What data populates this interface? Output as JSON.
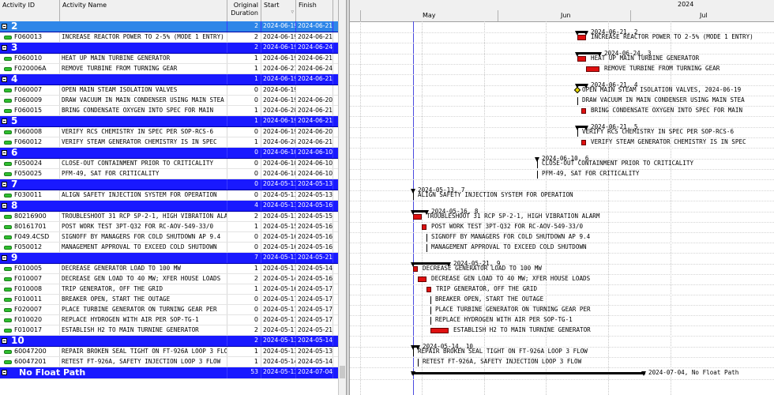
{
  "columns": {
    "id": "Activity ID",
    "name": "Activity Name",
    "dur1": "Original",
    "dur2": "Duration",
    "start": "Start",
    "finish": "Finish"
  },
  "timeline": {
    "year": "2024",
    "months": [
      "May",
      "Jun",
      "Jul"
    ]
  },
  "rows": [
    {
      "kind": "group",
      "label": "2",
      "dur": "2",
      "start": "2024-06-19",
      "finish": "2024-06-21",
      "selected": true
    },
    {
      "kind": "act",
      "id": "F060013",
      "name": "INCREASE REACTOR POWER TO 2-5% (MODE 1 ENTRY)",
      "dur": "2",
      "start": "2024-06-19",
      "finish": "2024-06-21"
    },
    {
      "kind": "group",
      "label": "3",
      "dur": "2",
      "start": "2024-06-19",
      "finish": "2024-06-24"
    },
    {
      "kind": "act",
      "id": "F060010",
      "name": "HEAT UP MAIN TURBINE GENERATOR",
      "dur": "1",
      "start": "2024-06-19",
      "finish": "2024-06-21"
    },
    {
      "kind": "act",
      "id": "F020006A",
      "name": "REMOVE TURBINE FROM TURNING GEAR",
      "dur": "1",
      "start": "2024-06-21",
      "finish": "2024-06-24"
    },
    {
      "kind": "group",
      "label": "4",
      "dur": "1",
      "start": "2024-06-19",
      "finish": "2024-06-21"
    },
    {
      "kind": "act",
      "id": "F060007",
      "name": "OPEN MAIN STEAM ISOLATION VALVES",
      "dur": "0",
      "start": "2024-06-19",
      "finish": ""
    },
    {
      "kind": "act",
      "id": "F060009",
      "name": "DRAW VACUUM IN MAIN CONDENSER USING MAIN STEA",
      "dur": "0",
      "start": "2024-06-19",
      "finish": "2024-06-20"
    },
    {
      "kind": "act",
      "id": "F060015",
      "name": "BRING CONDENSATE OXYGEN INTO SPEC FOR MAIN",
      "dur": "1",
      "start": "2024-06-20",
      "finish": "2024-06-21"
    },
    {
      "kind": "group",
      "label": "5",
      "dur": "1",
      "start": "2024-06-19",
      "finish": "2024-06-21"
    },
    {
      "kind": "act",
      "id": "F060008",
      "name": "VERIFY RCS CHEMISTRY IN SPEC PER SOP-RCS-6",
      "dur": "0",
      "start": "2024-06-19",
      "finish": "2024-06-20"
    },
    {
      "kind": "act",
      "id": "F060012",
      "name": "VERIFY STEAM GENERATOR CHEMISTRY IS IN SPEC",
      "dur": "1",
      "start": "2024-06-20",
      "finish": "2024-06-21"
    },
    {
      "kind": "group",
      "label": "6",
      "dur": "0",
      "start": "2024-06-10",
      "finish": "2024-06-10"
    },
    {
      "kind": "act",
      "id": "F050024",
      "name": "CLOSE-OUT CONTAINMENT PRIOR TO CRITICALITY",
      "dur": "0",
      "start": "2024-06-10",
      "finish": "2024-06-10"
    },
    {
      "kind": "act",
      "id": "F050025",
      "name": "PFM-49, SAT FOR CRITICALITY",
      "dur": "0",
      "start": "2024-06-10",
      "finish": "2024-06-10"
    },
    {
      "kind": "group",
      "label": "7",
      "dur": "0",
      "start": "2024-05-13",
      "finish": "2024-05-13"
    },
    {
      "kind": "act",
      "id": "F030011",
      "name": "ALIGN SAFETY INJECTION SYSTEM FOR OPERATION",
      "dur": "0",
      "start": "2024-05-13",
      "finish": "2024-05-13"
    },
    {
      "kind": "group",
      "label": "8",
      "dur": "4",
      "start": "2024-05-13",
      "finish": "2024-05-16"
    },
    {
      "kind": "act",
      "id": "80216900",
      "name": "TROUBLESHOOT 31 RCP SP-2-1, HIGH VIBRATION ALARM",
      "dur": "2",
      "start": "2024-05-13",
      "finish": "2024-05-15"
    },
    {
      "kind": "act",
      "id": "80161701",
      "name": "POST WORK TEST 3PT-Q32 FOR RC-AOV-549-33/0",
      "dur": "1",
      "start": "2024-05-15",
      "finish": "2024-05-16"
    },
    {
      "kind": "act",
      "id": "F049.4CSD",
      "name": "SIGNOFF BY MANAGERS FOR COLD SHUTDOWN  AP 9.4",
      "dur": "0",
      "start": "2024-05-16",
      "finish": "2024-05-16"
    },
    {
      "kind": "act",
      "id": "F050012",
      "name": "MANAGEMENT APPROVAL TO EXCEED COLD SHUTDOWN",
      "dur": "0",
      "start": "2024-05-16",
      "finish": "2024-05-16"
    },
    {
      "kind": "group",
      "label": "9",
      "dur": "7",
      "start": "2024-05-13",
      "finish": "2024-05-21"
    },
    {
      "kind": "act",
      "id": "F010005",
      "name": "DECREASE GENERATOR LOAD TO 100 MW",
      "dur": "1",
      "start": "2024-05-13",
      "finish": "2024-05-14"
    },
    {
      "kind": "act",
      "id": "F010007",
      "name": "DECREASE GEN LOAD TO 40 MW; XFER HOUSE LOADS",
      "dur": "2",
      "start": "2024-05-14",
      "finish": "2024-05-16"
    },
    {
      "kind": "act",
      "id": "F010008",
      "name": "TRIP GENERATOR,  OFF THE GRID",
      "dur": "1",
      "start": "2024-05-16",
      "finish": "2024-05-17"
    },
    {
      "kind": "act",
      "id": "F010011",
      "name": "BREAKER OPEN, START THE OUTAGE",
      "dur": "0",
      "start": "2024-05-17",
      "finish": "2024-05-17"
    },
    {
      "kind": "act",
      "id": "F020007",
      "name": "PLACE TURBINE GENERATOR ON TURNING GEAR PER",
      "dur": "0",
      "start": "2024-05-17",
      "finish": "2024-05-17"
    },
    {
      "kind": "act",
      "id": "F010020",
      "name": "REPLACE HYDROGEN WITH AIR PER SOP-TG-1",
      "dur": "0",
      "start": "2024-05-17",
      "finish": "2024-05-17"
    },
    {
      "kind": "act",
      "id": "F010017",
      "name": "ESTABLISH H2 TO MAIN TURNINE GENERATOR",
      "dur": "2",
      "start": "2024-05-17",
      "finish": "2024-05-21"
    },
    {
      "kind": "group",
      "label": "10",
      "dur": "2",
      "start": "2024-05-13",
      "finish": "2024-05-14"
    },
    {
      "kind": "act",
      "id": "60047200",
      "name": "REPAIR BROKEN SEAL TIGHT ON FT-926A LOOP 3 FLOW",
      "dur": "1",
      "start": "2024-05-13",
      "finish": "2024-05-13"
    },
    {
      "kind": "act",
      "id": "60047201",
      "name": "RETEST FT-926A, SAFETY INJECTION LOOP 3 FLOW",
      "dur": "1",
      "start": "2024-05-14",
      "finish": "2024-05-14"
    },
    {
      "kind": "nfp",
      "label": "No Float Path",
      "dur": "53",
      "start": "2024-05-13",
      "finish": "2024-07-04"
    }
  ],
  "gantt_labels": {
    "g2": "2024-06-21, 2",
    "g3": "2024-06-24, 3",
    "g4": "2024-06-21, 4",
    "a_open_msiv": "OPEN MAIN STEAM ISOLATION VALVES, 2024-06-19",
    "g5": "2024-06-21, 5",
    "g6": "2024-06-10, 6",
    "g7": "2024-05-13, 7",
    "g8": "2024-05-16, 8",
    "g9": "2024-05-21, 9",
    "g10": "2024-05-14, 10",
    "nfp": "2024-07-04, No Float Path"
  }
}
